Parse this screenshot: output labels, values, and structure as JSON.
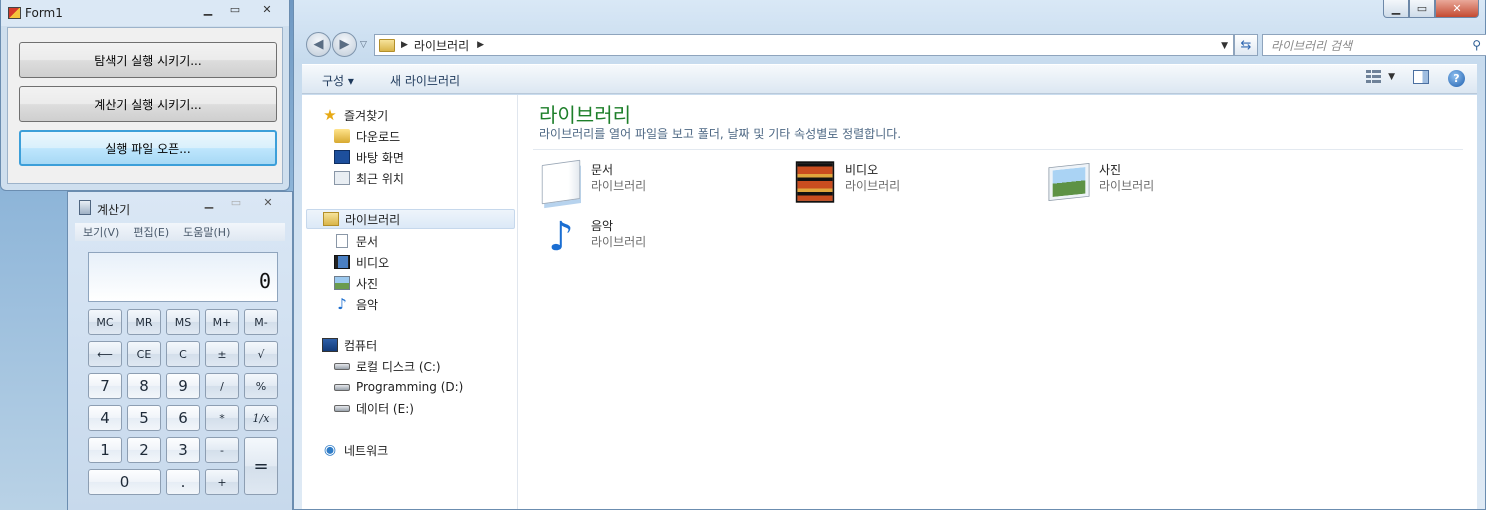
{
  "explorer": {
    "breadcrumb": "라이브러리",
    "search_placeholder": "라이브러리 검색",
    "toolbar": {
      "organize": "구성 ▾",
      "new_library": "새 라이브러리"
    },
    "nav": {
      "favorites": "즐겨찾기",
      "downloads": "다운로드",
      "desktop": "바탕 화면",
      "recent": "최근 위치",
      "libraries": "라이브러리",
      "documents": "문서",
      "videos": "비디오",
      "pictures": "사진",
      "music": "음악",
      "computer": "컴퓨터",
      "drive_c": "로컬 디스크 (C:)",
      "drive_d": "Programming (D:)",
      "drive_e": "데이터 (E:)",
      "network": "네트워크"
    },
    "content": {
      "title": "라이브러리",
      "subtitle": "라이브러리를 열어 파일을 보고 폴더, 날짜 및 기타 속성별로 정렬합니다.",
      "items": [
        {
          "name": "문서",
          "type": "라이브러리",
          "icon": "documents-library-icon"
        },
        {
          "name": "비디오",
          "type": "라이브러리",
          "icon": "videos-library-icon"
        },
        {
          "name": "사진",
          "type": "라이브러리",
          "icon": "pictures-library-icon"
        },
        {
          "name": "음악",
          "type": "라이브러리",
          "icon": "music-library-icon"
        }
      ]
    }
  },
  "form1": {
    "title": "Form1",
    "buttons": [
      "탐색기 실행 시키기...",
      "계산기 실행 시키기...",
      "실행 파일 오픈..."
    ]
  },
  "calculator": {
    "title": "계산기",
    "menu": [
      "보기(V)",
      "편집(E)",
      "도움말(H)"
    ],
    "display": "0",
    "keys": {
      "mc": "MC",
      "mr": "MR",
      "ms": "MS",
      "mplus": "M+",
      "mminus": "M-",
      "back": "⟵",
      "ce": "CE",
      "c": "C",
      "pm": "±",
      "sqrt": "√",
      "k7": "7",
      "k8": "8",
      "k9": "9",
      "div": "/",
      "pct": "%",
      "k4": "4",
      "k5": "5",
      "k6": "6",
      "mul": "*",
      "inv": "1/x",
      "k1": "1",
      "k2": "2",
      "k3": "3",
      "sub": "-",
      "eq": "=",
      "k0": "0",
      "dot": ".",
      "add": "+"
    }
  }
}
